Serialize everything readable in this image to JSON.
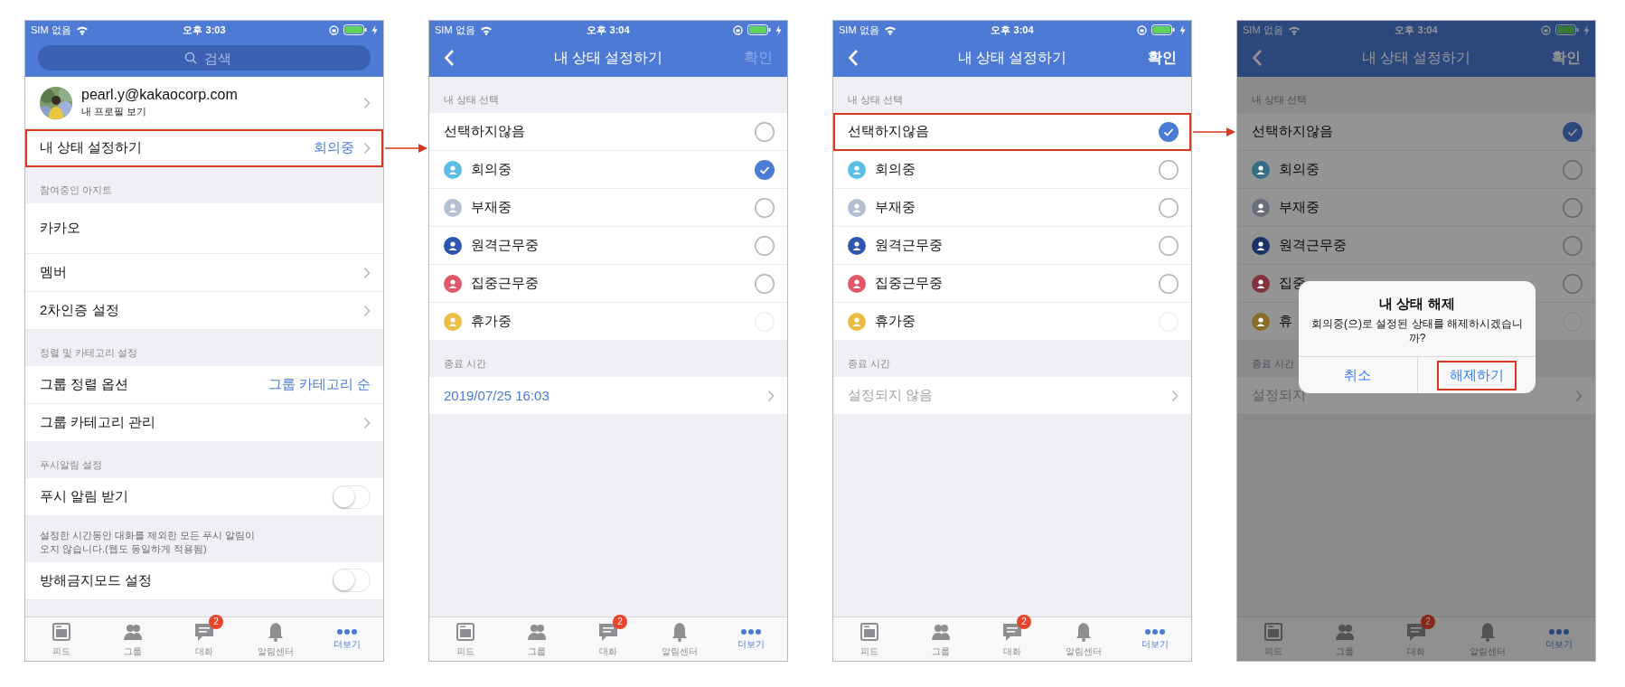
{
  "screens": [
    {
      "status_bar": {
        "carrier": "SIM 없음",
        "time": "오후 3:03"
      },
      "header": {
        "kind": "search",
        "placeholder": "검색"
      },
      "content": [
        {
          "kind": "profile",
          "email": "pearl.y@kakaocorp.com",
          "subtitle": "내 프로필 보기",
          "chevron": true
        },
        {
          "kind": "row",
          "label": "내 상태 설정하기",
          "value": "회의중",
          "chevron": true,
          "highlighted": true
        },
        {
          "kind": "section_header",
          "label": "참여중인 아지트"
        },
        {
          "kind": "workspace",
          "label": "카카오"
        },
        {
          "kind": "row",
          "label": "멤버",
          "chevron": true,
          "highlighted": false
        },
        {
          "kind": "row",
          "label": "2차인증 설정",
          "chevron": true,
          "highlighted": false
        },
        {
          "kind": "section_header",
          "label": "정렬 및 카테고리 설정"
        },
        {
          "kind": "row",
          "label": "그룹 정렬 옵션",
          "value": "그룹 카테고리 순",
          "chevron": false,
          "highlighted": false
        },
        {
          "kind": "row",
          "label": "그룹 카테고리 관리",
          "chevron": true,
          "highlighted": false
        },
        {
          "kind": "section_header",
          "label": "푸시알림 설정"
        },
        {
          "kind": "row",
          "label": "푸시 알림 받기",
          "chevron": false,
          "toggle": {
            "on": false
          },
          "highlighted": false
        },
        {
          "kind": "note",
          "text": "설정한 시간동안 대화를 제외한 모든 푸시 알림이 오지 않습니다.(웹도 동일하게 적용됨)"
        },
        {
          "kind": "row",
          "label": "방해금지모드 설정",
          "chevron": false,
          "toggle": {
            "on": false
          },
          "highlighted": false
        }
      ],
      "tab_bar": [
        {
          "label": "피드",
          "selected": false
        },
        {
          "label": "그룹",
          "selected": false
        },
        {
          "label": "대화",
          "badge": "2",
          "selected": false
        },
        {
          "label": "알림센터",
          "selected": false
        },
        {
          "label": "더보기",
          "selected": true
        }
      ],
      "dimmed": false
    },
    {
      "status_bar": {
        "carrier": "SIM 없음",
        "time": "오후 3:04"
      },
      "header": {
        "kind": "nav",
        "title": "내 상태 설정하기",
        "action": {
          "label": "확인",
          "disabled": true
        }
      },
      "content": [
        {
          "kind": "section_header",
          "label": "내 상태 선택"
        },
        {
          "kind": "radio",
          "label": "선택하지않음",
          "checked": false,
          "disabled": false,
          "highlighted": false
        },
        {
          "kind": "radio",
          "label": "회의중",
          "color": "#5bbde6",
          "checked": true,
          "disabled": false,
          "highlighted": false
        },
        {
          "kind": "radio",
          "label": "부재중",
          "color": "#b3bfd3",
          "checked": false,
          "disabled": false,
          "highlighted": false
        },
        {
          "kind": "radio",
          "label": "원격근무중",
          "color": "#2e56b0",
          "checked": false,
          "disabled": false,
          "highlighted": false
        },
        {
          "kind": "radio",
          "label": "집중근무중",
          "color": "#e2566a",
          "checked": false,
          "disabled": false,
          "highlighted": false
        },
        {
          "kind": "radio",
          "label": "휴가중",
          "color": "#ecbd44",
          "checked": false,
          "disabled": true,
          "highlighted": false
        },
        {
          "kind": "section_header",
          "label": "종료 시간"
        },
        {
          "kind": "value_row",
          "value": "2019/07/25 16:03",
          "chevron": true
        }
      ],
      "tab_bar": [
        {
          "label": "피드",
          "selected": false
        },
        {
          "label": "그룹",
          "selected": false
        },
        {
          "label": "대화",
          "badge": "2",
          "selected": false
        },
        {
          "label": "알림센터",
          "selected": false
        },
        {
          "label": "더보기",
          "selected": true
        }
      ],
      "dimmed": false
    },
    {
      "status_bar": {
        "carrier": "SIM 없음",
        "time": "오후 3:04"
      },
      "header": {
        "kind": "nav",
        "title": "내 상태 설정하기",
        "action": {
          "label": "확인",
          "disabled": false
        }
      },
      "content": [
        {
          "kind": "section_header",
          "label": "내 상태 선택"
        },
        {
          "kind": "radio",
          "label": "선택하지않음",
          "checked": true,
          "disabled": false,
          "highlighted": true
        },
        {
          "kind": "radio",
          "label": "회의중",
          "color": "#5bbde6",
          "checked": false,
          "disabled": false,
          "highlighted": false
        },
        {
          "kind": "radio",
          "label": "부재중",
          "color": "#b3bfd3",
          "checked": false,
          "disabled": false,
          "highlighted": false
        },
        {
          "kind": "radio",
          "label": "원격근무중",
          "color": "#2e56b0",
          "checked": false,
          "disabled": false,
          "highlighted": false
        },
        {
          "kind": "radio",
          "label": "집중근무중",
          "color": "#e2566a",
          "checked": false,
          "disabled": false,
          "highlighted": false
        },
        {
          "kind": "radio",
          "label": "휴가중",
          "color": "#ecbd44",
          "checked": false,
          "disabled": true,
          "highlighted": false
        },
        {
          "kind": "section_header",
          "label": "종료 시간"
        },
        {
          "kind": "value_row",
          "placeholder": "설정되지 않음",
          "chevron": true
        }
      ],
      "tab_bar": [
        {
          "label": "피드",
          "selected": false
        },
        {
          "label": "그룹",
          "selected": false
        },
        {
          "label": "대화",
          "badge": "2",
          "selected": false
        },
        {
          "label": "알림센터",
          "selected": false
        },
        {
          "label": "더보기",
          "selected": true
        }
      ],
      "dimmed": false
    },
    {
      "status_bar": {
        "carrier": "SIM 없음",
        "time": "오후 3:04"
      },
      "header": {
        "kind": "nav",
        "title": "내 상태 설정하기",
        "action": {
          "label": "확인",
          "disabled": false
        }
      },
      "content": [
        {
          "kind": "section_header",
          "label": "내 상태 선택"
        },
        {
          "kind": "radio",
          "label": "선택하지않음",
          "checked": true,
          "disabled": false,
          "highlighted": false
        },
        {
          "kind": "radio",
          "label": "회의중",
          "color": "#356e85",
          "checked": false,
          "disabled": false,
          "highlighted": false
        },
        {
          "kind": "radio",
          "label": "부재중",
          "color": "#686f7a",
          "checked": false,
          "disabled": false,
          "highlighted": false
        },
        {
          "kind": "radio",
          "label": "원격근무중",
          "color": "#1b3266",
          "checked": false,
          "disabled": false,
          "highlighted": false
        },
        {
          "kind": "radio",
          "label": "집중",
          "color": "#83323d",
          "checked": false,
          "disabled": false,
          "highlighted": false
        },
        {
          "kind": "radio",
          "label": "휴",
          "color": "#896e27",
          "checked": false,
          "disabled": true,
          "highlighted": false
        },
        {
          "kind": "section_header",
          "label": "종료 시간"
        },
        {
          "kind": "value_row",
          "placeholder": "설정되지",
          "chevron": true
        }
      ],
      "tab_bar": [
        {
          "label": "피드",
          "selected": false
        },
        {
          "label": "그룹",
          "selected": false
        },
        {
          "label": "대화",
          "badge": "2",
          "selected": false
        },
        {
          "label": "알림센터",
          "selected": false
        },
        {
          "label": "더보기",
          "selected": true
        }
      ],
      "dimmed": true,
      "dialog": {
        "title": "내 상태 해제",
        "message": "회의중(으)로 설정된 상태를 해제하시겠습니까?",
        "buttons": [
          {
            "label": "취소",
            "highlighted": false
          },
          {
            "label": "해제하기",
            "highlighted": true
          }
        ]
      }
    }
  ]
}
